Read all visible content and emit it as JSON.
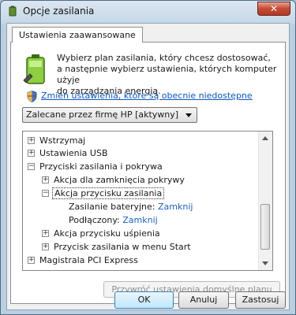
{
  "window": {
    "title": "Opcje zasilania",
    "close_glyph": "✕"
  },
  "tab": {
    "label": "Ustawienia zaawansowane"
  },
  "intro": {
    "lines": [
      "Wybierz plan zasilania, który chcesz dostosować,",
      "a następnie wybierz ustawienia, których komputer użyje",
      "do zarządzania energią."
    ]
  },
  "link": {
    "label": "Zmień ustawienia, które są obecnie niedostępne"
  },
  "plan": {
    "selected": "Zalecane przez firmę HP [aktywny]"
  },
  "tree": {
    "items": [
      {
        "label": "Wstrzymaj",
        "expander": "+"
      },
      {
        "label": "Ustawienia USB",
        "expander": "+"
      },
      {
        "label": "Przyciski zasilania i pokrywa",
        "expander": "−"
      },
      {
        "label": "Akcja dla zamknięcia pokrywy",
        "expander": "+"
      },
      {
        "label": "Akcja przycisku zasilania",
        "expander": "−"
      },
      {
        "label": "Zasilanie bateryjne:",
        "value": "Zamknij"
      },
      {
        "label": "Podłączony:",
        "value": "Zamknij"
      },
      {
        "label": "Akcja przycisku uśpienia",
        "expander": "+"
      },
      {
        "label": "Przycisk zasilania w menu Start",
        "expander": "+"
      },
      {
        "label": "Magistrala PCI Express",
        "expander": "+"
      }
    ]
  },
  "buttons": {
    "restore": "Przywróć ustawienia domyślne planu",
    "ok": "OK",
    "cancel": "Anuluj",
    "apply": "Zastosuj"
  },
  "icons": {
    "app": "battery-icon",
    "battery": "battery-icon",
    "shield": "shield-icon"
  }
}
